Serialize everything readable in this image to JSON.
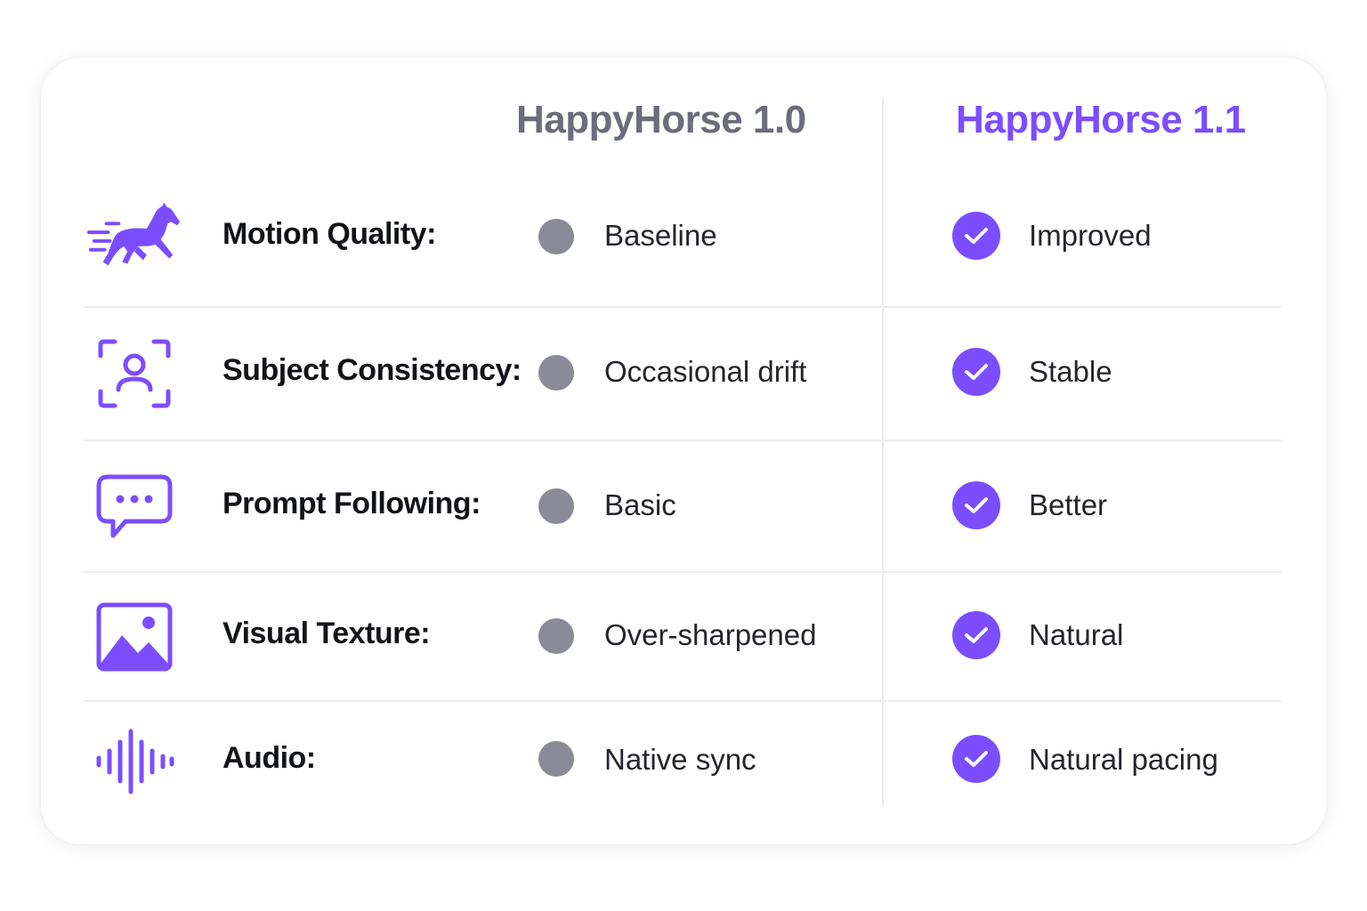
{
  "headers": {
    "col_old": "HappyHorse 1.0",
    "col_new": "HappyHorse 1.1"
  },
  "colors": {
    "accent": "#7c4dff",
    "old_dot": "#8a8b96",
    "old_header": "#6b6d7b"
  },
  "rows": [
    {
      "label": "Motion Quality:",
      "icon": "running-horse-icon",
      "old": "Baseline",
      "new": "Improved"
    },
    {
      "label": "Subject Consistency:",
      "icon": "face-scan-icon",
      "old": "Occasional drift",
      "new": "Stable"
    },
    {
      "label": "Prompt Following:",
      "icon": "chat-bubble-icon",
      "old": "Basic",
      "new": "Better"
    },
    {
      "label": "Visual Texture:",
      "icon": "image-icon",
      "old": "Over-sharpened",
      "new": "Natural"
    },
    {
      "label": "Audio:",
      "icon": "audio-waveform-icon",
      "old": "Native sync",
      "new": "Natural pacing"
    }
  ]
}
